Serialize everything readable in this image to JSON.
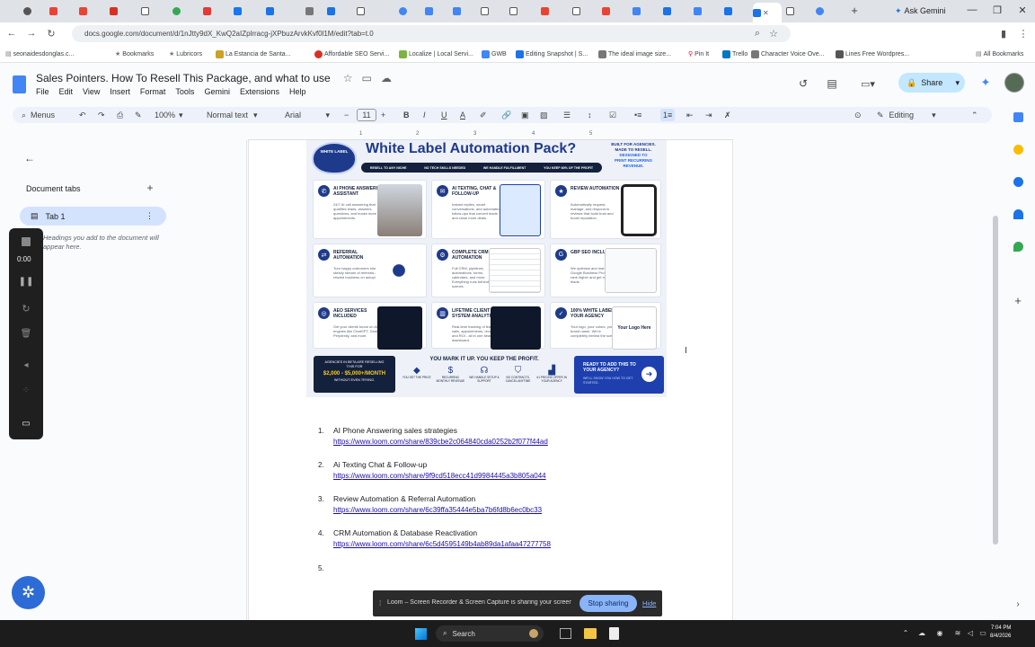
{
  "browser": {
    "url": "docs.google.com/document/d/1nJtty9dX_KwQ2aIZplrracg-jXPbuzArvkKvf0l1M/edit?tab=t.0",
    "ask_gemini": "Ask Gemini"
  },
  "bookmarks": [
    {
      "label": "seonaidesdonglas.c...",
      "icon": "folder-icon"
    },
    {
      "label": "Bookmarks",
      "icon": "star-icon"
    },
    {
      "label": "Lubricors",
      "icon": "star-icon"
    },
    {
      "label": "La Estancia de Santa...",
      "icon": "site-icon"
    },
    {
      "label": "Affordable SEO Servi...",
      "icon": "site-icon"
    },
    {
      "label": "Localize | Local Servi...",
      "icon": "site-icon"
    },
    {
      "label": "GWB",
      "icon": "site-icon"
    },
    {
      "label": "Editing Snapshot | S...",
      "icon": "site-icon"
    },
    {
      "label": "The ideal image size...",
      "icon": "site-icon"
    },
    {
      "label": "Pin It",
      "icon": "pin-icon"
    },
    {
      "label": "Trello",
      "icon": "site-icon"
    },
    {
      "label": "Character Voice Ove...",
      "icon": "site-icon"
    },
    {
      "label": "Lines Free Wordpres...",
      "icon": "site-icon"
    },
    {
      "label": "All Bookmarks",
      "icon": "folder-icon"
    }
  ],
  "doc": {
    "title": "Sales Pointers. How To Resell This Package, and what to use",
    "menu": [
      "File",
      "Edit",
      "View",
      "Insert",
      "Format",
      "Tools",
      "Gemini",
      "Extensions",
      "Help"
    ],
    "share_label": "Share"
  },
  "toolbar": {
    "menus_label": "Menus",
    "zoom": "100%",
    "style": "Normal text",
    "font": "Arial",
    "font_size": "11",
    "mode": "Editing"
  },
  "left_panel": {
    "heading": "Document tabs",
    "tab_label": "Tab 1",
    "hint": "Headings you add to the document will appear here."
  },
  "recorder": {
    "time": "0:00"
  },
  "infographic": {
    "headline": "White Label Automation Pack?",
    "badge": "WHITE LABEL",
    "side_note": [
      "BUILT FOR AGENCIES.",
      "MADE TO RESELL.",
      "DESIGNED TO",
      "PRINT RECURRING",
      "REVENUE."
    ],
    "pills": [
      "RESELL TO ANY NICHE",
      "NO TECH SKILLS NEEDED",
      "WE HANDLE FULFILLMENT",
      "YOU KEEP 80% OF THE PROFIT"
    ],
    "cards": [
      {
        "title": "AI PHONE ANSWERING ASSISTANT",
        "desc": "24/7 AI call answering that qualifies leads, answers questions, and books more appointments."
      },
      {
        "title": "AI TEXTING, CHAT & FOLLOW-UP",
        "desc": "Instant replies, smart conversations, and automated follow-ups that convert leads and close more deals."
      },
      {
        "title": "REVIEW AUTOMATION",
        "desc": "Automatically request, manage, and respond to reviews that build trust and boost reputation."
      },
      {
        "title": "REFERRAL AUTOMATION",
        "desc": "Turn happy customers into a steady stream of referrals and reward business on autopilot."
      },
      {
        "title": "COMPLETE CRM & AUTOMATION",
        "desc": "Full CRM, pipelines, automations, forms, calendars, and more. Everything runs behind the scenes."
      },
      {
        "title": "GBP SEO INCLUDED",
        "desc": "We optimize and manage Google Business Profiles to rank higher and get more leads."
      },
      {
        "title": "AEO SERVICES INCLUDED",
        "desc": "Get your clients found on AI engines like ChatGPT, Grok, Perplexity, and more."
      },
      {
        "title": "LIFETIME CLIENT SYSTEM ANALYTICS",
        "desc": "Real-time tracking of leads, calls, appointments, revenue and ROI - all in one beautiful dashboard."
      },
      {
        "title": "100% WHITE LABEL TO YOUR AGENCY",
        "desc": "Your logo, your colors, your brand name. We're completely behind the scenes."
      }
    ],
    "your_logo": "Your Logo Here",
    "promo": {
      "line1": "AGENCIES IN BETA ARE RESELLING THIS FOR",
      "price": "$2,000 - $5,000+/MONTH",
      "line3": "WITHOUT EVEN TRYING."
    },
    "markup_title": "YOU MARK IT UP. YOU KEEP THE PROFIT.",
    "markup_items": [
      "YOU SET THE PRICE",
      "RECURRING MONTHLY REVENUE",
      "WE HANDLE SETUP & SUPPORT",
      "NO CONTRACTS. CANCEL ANYTIME",
      "#1 PRICING OFFER IN YOUR AGENCY"
    ],
    "cta": {
      "title": "READY TO ADD THIS TO YOUR AGENCY?",
      "sub": "WE'LL SHOW YOU HOW TO GET STARTED."
    }
  },
  "list": [
    {
      "num": "1.",
      "title": "AI Phone Answering sales strategies",
      "link": "https://www.loom.com/share/839cbe2c064840cda0252b2f077f44ad"
    },
    {
      "num": "2.",
      "title": "Ai Texting Chat & Follow-up",
      "link": "https://www.loom.com/share/9f9cd518ecc41d9984445a3b805a044"
    },
    {
      "num": "3.",
      "title": "Review Automation & Referral Automation",
      "link": "https://www.loom.com/share/6c39ffa35444e5ba7b6fd8b6ec0bc33"
    },
    {
      "num": "4.",
      "title": "CRM Automation & Database Reactivation",
      "link": "https://www.loom.com/share/6c5d4595149b4ab89da1afaa47277758"
    },
    {
      "num": "5.",
      "title": "",
      "link": ""
    }
  ],
  "sharebar": {
    "text": "Loom – Screen Recorder & Screen Capture is sharing your screen.",
    "stop": "Stop sharing",
    "hide": "Hide"
  },
  "taskbar": {
    "search": "Search",
    "time": "7:04 PM",
    "date": "8/4/2026"
  },
  "colors": {
    "accent": "#1a73e8",
    "share_bg": "#c2e7ff",
    "tab_selected": "#d3e3fd",
    "navy": "#14213d",
    "link": "#1a0dab"
  }
}
